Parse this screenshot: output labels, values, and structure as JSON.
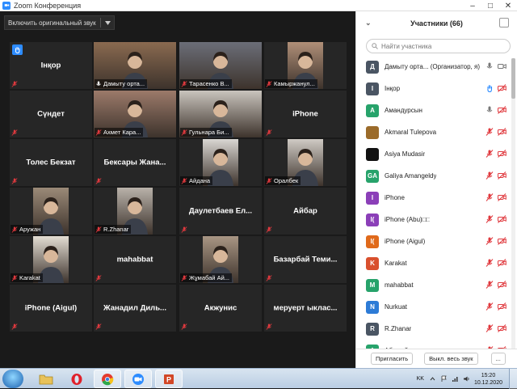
{
  "window": {
    "title": "Zoom Конференция",
    "controls": [
      "–",
      "□",
      "✕"
    ]
  },
  "toolbar": {
    "original_sound_label": "Включить оригинальный звук",
    "dropdown_icon": "chevron-down-icon"
  },
  "tiles": [
    {
      "label": "Інқор",
      "kind": "name",
      "hand": true
    },
    {
      "label": "Дамыту орта...",
      "kind": "video",
      "active": true,
      "bg": "#8a6a50"
    },
    {
      "label": "Тарасенко В...",
      "kind": "video",
      "bg": "#6b6e78"
    },
    {
      "label": "Камыржанул...",
      "kind": "video",
      "bg": "#b08f78"
    },
    {
      "label": "Сүндет",
      "kind": "name"
    },
    {
      "label": "Ахмет Кара...",
      "kind": "video",
      "bg": "#9c7a6a"
    },
    {
      "label": "Гульнара Би...",
      "kind": "video",
      "bg": "#c9c4bd"
    },
    {
      "label": "iPhone",
      "kind": "name"
    },
    {
      "label": "Толес Бекзат",
      "kind": "name"
    },
    {
      "label": "Бексары Жана...",
      "kind": "name"
    },
    {
      "label": "Айдана",
      "kind": "video",
      "bg": "#d9d6d2"
    },
    {
      "label": "Оралбек",
      "kind": "video",
      "bg": "#cfcac4"
    },
    {
      "label": "Аружан",
      "kind": "video",
      "bg": "#9b8a78"
    },
    {
      "label": "R.Zhanar",
      "kind": "video",
      "bg": "#b9b2aa"
    },
    {
      "label": "Даулетбаев Ел...",
      "kind": "name"
    },
    {
      "label": "Айбар",
      "kind": "name"
    },
    {
      "label": "Karakat",
      "kind": "video",
      "bg": "#e3ddd3"
    },
    {
      "label": "mahabbat",
      "kind": "name"
    },
    {
      "label": "Жұмабай Ай...",
      "kind": "video",
      "bg": "#a99684"
    },
    {
      "label": "Базарбай Теми...",
      "kind": "name"
    },
    {
      "label": "iPhone (Aigul)",
      "kind": "name"
    },
    {
      "label": "Жанадил Диль...",
      "kind": "name"
    },
    {
      "label": "Акжунис",
      "kind": "name"
    },
    {
      "label": "меруерт ыклас...",
      "kind": "name"
    }
  ],
  "panel": {
    "title": "Участники (66)",
    "search_placeholder": "Найти участника",
    "participants": [
      {
        "initial": "Д",
        "name": "Дамыту орта...  (Организатор, я)",
        "color": "#4a5563",
        "mic": "on",
        "video": "on"
      },
      {
        "initial": "I",
        "name": "Інқор",
        "color": "#4a5563",
        "mic": "hand",
        "video": "off"
      },
      {
        "initial": "А",
        "name": "Амандурсын",
        "color": "#27a36b",
        "mic": "on",
        "video": "off"
      },
      {
        "initial": "",
        "name": "Akmaral Tulepova",
        "color": "#9b6b2a",
        "mic": "off",
        "video": "off"
      },
      {
        "initial": "",
        "name": "Asiya Mudasir",
        "color": "#111111",
        "mic": "off",
        "video": "off"
      },
      {
        "initial": "GA",
        "name": "Galiya Amangeldy",
        "color": "#27a36b",
        "mic": "off",
        "video": "off"
      },
      {
        "initial": "I",
        "name": "iPhone",
        "color": "#8b3fb8",
        "mic": "off",
        "video": "off"
      },
      {
        "initial": "I(",
        "name": "iPhone (Abu)□□",
        "color": "#8b3fb8",
        "mic": "off",
        "video": "off"
      },
      {
        "initial": "I(",
        "name": "iPhone (Aigul)",
        "color": "#e06a1b",
        "mic": "off",
        "video": "off"
      },
      {
        "initial": "K",
        "name": "Karakat",
        "color": "#d9502e",
        "mic": "off",
        "video": "off"
      },
      {
        "initial": "M",
        "name": "mahabbat",
        "color": "#27a36b",
        "mic": "off",
        "video": "off"
      },
      {
        "initial": "N",
        "name": "Nurkuat",
        "color": "#2d7bd6",
        "mic": "off",
        "video": "off"
      },
      {
        "initial": "R",
        "name": "R.Zhanar",
        "color": "#4a5563",
        "mic": "off",
        "video": "off"
      },
      {
        "initial": "А",
        "name": "Абылай",
        "color": "#27a36b",
        "mic": "off",
        "video": "off"
      }
    ],
    "footer": {
      "invite_label": "Пригласить",
      "mute_all_label": "Выкл. весь звук",
      "more_label": "..."
    }
  },
  "taskbar": {
    "apps": [
      "folder-icon",
      "opera-icon",
      "chrome-icon",
      "zoom-icon",
      "powerpoint-icon"
    ],
    "lang": "KK",
    "time": "15:20",
    "date": "10.12.2020"
  },
  "colors": {
    "accent": "#2d8cff",
    "muted_red": "#e0393e",
    "active_outline": "#a3d43a"
  }
}
